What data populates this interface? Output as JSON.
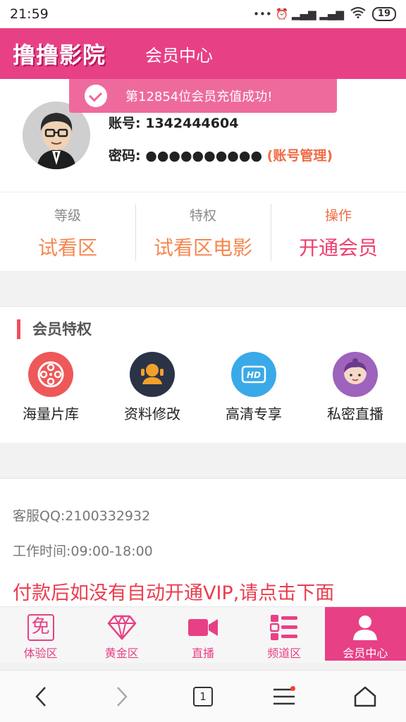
{
  "status_bar": {
    "time": "21:59",
    "icons": "••• ⏰ ▂▄▆ ▂▄▆",
    "battery": "19"
  },
  "header": {
    "logo": "撸撸影院",
    "title": "会员中心"
  },
  "toast": {
    "message": "第12854位会员充值成功!"
  },
  "profile": {
    "account_label": "账号:",
    "account_value": "1342444604",
    "password_label": "密码:",
    "password_value": "●●●●●●●●●●",
    "manage_link": "(账号管理)"
  },
  "stats": [
    {
      "label": "等级",
      "value": "试看区"
    },
    {
      "label": "特权",
      "value": "试看区电影"
    },
    {
      "label": "操作",
      "value": "开通会员"
    }
  ],
  "privileges": {
    "title": "会员特权",
    "items": [
      {
        "label": "海量片库",
        "icon": "film-reel-icon",
        "color": "#ee5858"
      },
      {
        "label": "资料修改",
        "icon": "user-edit-icon",
        "color": "#2b3347"
      },
      {
        "label": "高清专享",
        "icon": "hd-icon",
        "color": "#3aa9e8"
      },
      {
        "label": "私密直播",
        "icon": "girl-icon",
        "color": "#9d63bd"
      }
    ]
  },
  "info": {
    "qq": "客服QQ:2100332932",
    "hours": "工作时间:09:00-18:00",
    "warning": "付款后如没有自动开通VIP,请点击下面"
  },
  "bottom_nav": {
    "items": [
      {
        "label": "体验区",
        "icon": "free-icon",
        "glyph": "免"
      },
      {
        "label": "黄金区",
        "icon": "diamond-icon"
      },
      {
        "label": "直播",
        "icon": "video-camera-icon"
      },
      {
        "label": "频道区",
        "icon": "list-icon"
      },
      {
        "label": "会员中心",
        "icon": "user-icon",
        "active": true
      }
    ]
  },
  "system_nav": {
    "tab_count": "1"
  },
  "colors": {
    "brand": "#e84085",
    "accent_orange": "#f5874f",
    "warning_red": "#ea3d4e"
  }
}
